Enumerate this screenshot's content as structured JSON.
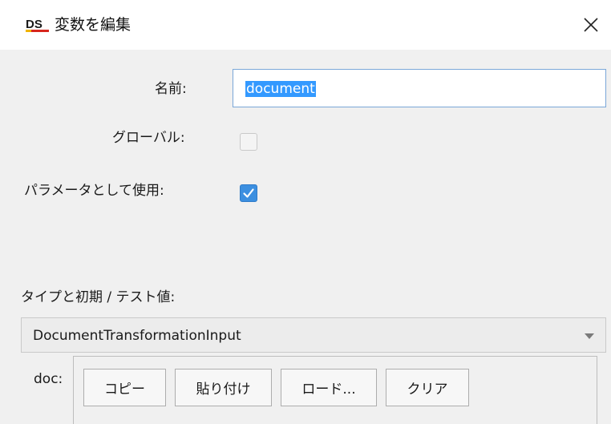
{
  "window": {
    "app_logo_text": "DS",
    "title": "変数を編集",
    "close_glyph": "×"
  },
  "form": {
    "name_label": "名前:",
    "name_value": "document",
    "global_label": "グローバル:",
    "global_checked": false,
    "use_as_param_label": "パラメータとして使用:",
    "use_as_param_checked": true,
    "type_section_label": "タイプと初期 / テスト値:",
    "type_selected": "DocumentTransformationInput"
  },
  "doc": {
    "label": "doc:",
    "buttons": {
      "copy": "コピー",
      "paste": "貼り付け",
      "load": "ロード...",
      "clear": "クリア"
    }
  },
  "colors": {
    "accent": "#3c8fe0",
    "selection": "#3399ff",
    "logo_red": "#d7261e",
    "panel_bg": "#f0f0f0"
  },
  "icons": {
    "close": "close-icon",
    "check": "check-icon",
    "dropdown": "chevron-down-icon"
  }
}
